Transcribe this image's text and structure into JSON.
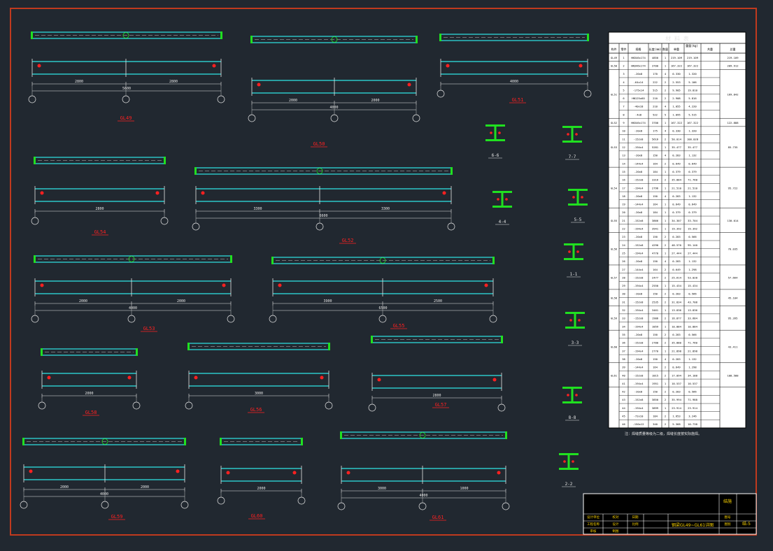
{
  "colors": {
    "background": "#212830",
    "frame": "#c03a1e",
    "beam_cyan": "#2fe6e6",
    "plate_green": "#20e020",
    "dim_white": "#e6e6e6",
    "label_red": "#ff2020",
    "table_bg": "#ffffff",
    "titleblock_yellow": "#ffd700"
  },
  "beams": [
    {
      "title": "GL49",
      "dims": [
        "2800",
        "2800"
      ],
      "total": "5600"
    },
    {
      "title": "GL50",
      "dims": [
        "2000",
        "2000"
      ],
      "total": "4000"
    },
    {
      "title": "GL51",
      "dims": [],
      "total": "4000"
    },
    {
      "title": "GL54",
      "dims": [],
      "total": "2800"
    },
    {
      "title": "GL52",
      "dims": [
        "3300",
        "3300"
      ],
      "total": "6600"
    },
    {
      "title": "GL53",
      "dims": [
        "2000",
        "2000"
      ],
      "total": "4000"
    },
    {
      "title": "GL55",
      "dims": [
        "3900",
        "2500"
      ],
      "total": "6500"
    },
    {
      "title": "GL58",
      "dims": [],
      "total": "2000"
    },
    {
      "title": "GL56",
      "dims": [],
      "total": "3000"
    },
    {
      "title": "GL57",
      "dims": [],
      "total": "2800"
    },
    {
      "title": "GL59",
      "dims": [
        "2000",
        "2000"
      ],
      "total": "4000"
    },
    {
      "title": "GL60",
      "dims": [],
      "total": "2000"
    },
    {
      "title": "GL61",
      "dims": [
        "3000",
        "1000"
      ],
      "total": "4000"
    }
  ],
  "sections": [
    "6-6",
    "7-7",
    "4-4",
    "5-5",
    "1-1",
    "3-3",
    "8-8",
    "2-2"
  ],
  "table": {
    "title": "材 料 表",
    "headers": [
      "构件",
      "零件",
      "规格",
      "长度(mm)",
      "数量",
      "重量(kg)",
      "单重",
      "共重",
      "总重"
    ],
    "groups": [
      {
        "name": "GL49",
        "total": "219.109"
      },
      {
        "name": "GL50",
        "total": "209.912"
      },
      {
        "name": "GL51",
        "total": "169.842"
      },
      {
        "name": "GL52",
        "total": "122.888"
      },
      {
        "name": "GL53",
        "total": "85.735"
      },
      {
        "name": "GL54",
        "total": "95.722"
      },
      {
        "name": "GL55",
        "total": "130.014"
      },
      {
        "name": "GL56",
        "total": "70.035"
      },
      {
        "name": "GL57",
        "total": "57.664"
      },
      {
        "name": "GL58",
        "total": "45.104"
      },
      {
        "name": "GL59",
        "total": "95.395"
      },
      {
        "name": "GL60",
        "total": "43.411"
      },
      {
        "name": "GL61",
        "total": "108.588"
      }
    ],
    "rows": [
      [
        "1",
        "HN346x174",
        "4850",
        "1",
        "219.109",
        "219.109"
      ],
      [
        "2",
        "HN346x174",
        "3700",
        "1",
        "167.322",
        "167.322"
      ],
      [
        "3",
        "-20x8",
        "170",
        "4",
        "0.330",
        "1.320"
      ],
      [
        "4",
        "-64x14",
        "222",
        "2",
        "2.553",
        "5.106"
      ],
      [
        "5",
        "-175x14",
        "515",
        "2",
        "9.905",
        "19.810"
      ],
      [
        "6",
        "HN125x60",
        "210",
        "2",
        "2.908",
        "5.816"
      ],
      [
        "7",
        "-40x18",
        "210",
        "4",
        "1.055",
        "4.220"
      ],
      [
        "8",
        "-4x8",
        "522",
        "5",
        "1.095",
        "5.515"
      ],
      [
        "9",
        "HN346x174",
        "3700",
        "1",
        "167.322",
        "167.322"
      ],
      [
        "10",
        "-20x8",
        "175",
        "4",
        "0.330",
        "1.320"
      ],
      [
        "11",
        "-152x8",
        "5616",
        "2",
        "50.014",
        "100.028"
      ],
      [
        "12",
        "-194x4",
        "5281",
        "1",
        "35.477",
        "35.477"
      ],
      [
        "13",
        "-20x8",
        "150",
        "4",
        "0.283",
        "1.132"
      ],
      [
        "14",
        "-144x4",
        "164",
        "2",
        "0.649",
        "0.649"
      ],
      [
        "15",
        "-20x8",
        "184",
        "1",
        "0.379",
        "0.379"
      ],
      [
        "16",
        "-152x8",
        "3316",
        "2",
        "35.884",
        "71.768"
      ],
      [
        "17",
        "-194x4",
        "2796",
        "1",
        "21.510",
        "21.510"
      ],
      [
        "18",
        "-20x8",
        "150",
        "4",
        "0.283",
        "1.132"
      ],
      [
        "19",
        "-144x4",
        "164",
        "1",
        "0.649",
        "0.649"
      ],
      [
        "20",
        "-20x8",
        "184",
        "1",
        "0.379",
        "0.379"
      ],
      [
        "21",
        "-152x8",
        "3866",
        "1",
        "34.307",
        "33.704"
      ],
      [
        "22",
        "-194x4",
        "3941",
        "1",
        "19.392",
        "19.392"
      ],
      [
        "23",
        "-20x8",
        "150",
        "2",
        "0.283",
        "0.566"
      ],
      [
        "24",
        "-152x8",
        "4290",
        "2",
        "48.570",
        "95.140"
      ],
      [
        "25",
        "-194x4",
        "4770",
        "1",
        "27.444",
        "27.444"
      ],
      [
        "26",
        "-20x8",
        "150",
        "4",
        "0.283",
        "1.132"
      ],
      [
        "27",
        "-144x4",
        "164",
        "2",
        "0.649",
        "1.298"
      ],
      [
        "28",
        "-152x8",
        "2477",
        "2",
        "25.614",
        "53.028"
      ],
      [
        "29",
        "-194x4",
        "2550",
        "1",
        "15.434",
        "15.434"
      ],
      [
        "30",
        "-20x8",
        "150",
        "2",
        "0.283",
        "0.566"
      ],
      [
        "31",
        "-152x8",
        "2535",
        "2",
        "31.834",
        "43.708"
      ],
      [
        "32",
        "-194x4",
        "3461",
        "1",
        "13.836",
        "13.836"
      ],
      [
        "33",
        "-152x8",
        "1906",
        "2",
        "16.877",
        "33.684"
      ],
      [
        "34",
        "-194x4",
        "1859",
        "1",
        "10.884",
        "10.884"
      ],
      [
        "35",
        "-20x8",
        "150",
        "2",
        "0.283",
        "0.566"
      ],
      [
        "36",
        "-152x8",
        "2780",
        "2",
        "35.880",
        "71.760"
      ],
      [
        "37",
        "-194x4",
        "2770",
        "1",
        "21.898",
        "21.898"
      ],
      [
        "38",
        "-20x8",
        "150",
        "4",
        "0.283",
        "1.132"
      ],
      [
        "39",
        "-144x4",
        "164",
        "2",
        "0.649",
        "1.298"
      ],
      [
        "40",
        "-152x8",
        "1815",
        "2",
        "17.094",
        "34.188"
      ],
      [
        "41",
        "-194x4",
        "1951",
        "1",
        "10.537",
        "10.537"
      ],
      [
        "42",
        "-20x8",
        "150",
        "2",
        "0.283",
        "0.566"
      ],
      [
        "43",
        "-152x8",
        "3850",
        "2",
        "35.994",
        "71.988"
      ],
      [
        "44",
        "-194x4",
        "3899",
        "1",
        "23.914",
        "23.914"
      ],
      [
        "45",
        "-72x10",
        "184",
        "2",
        "1.653",
        "3.246"
      ],
      [
        "46",
        "-150x12",
        "340",
        "2",
        "5.368",
        "10.738"
      ]
    ],
    "note": "注：焊缝质量等级为二级，焊缝长度按实际施焊。"
  },
  "titleblock": {
    "drawing_name": "钢梁GL49~GL61详图",
    "sheet_label": "结施",
    "sheet_no": "结-5",
    "label_cells": [
      "设计单位",
      "工程名称",
      "审核",
      "校对",
      "设计",
      "制图",
      "日期",
      "比例",
      "图号",
      "图别"
    ]
  }
}
